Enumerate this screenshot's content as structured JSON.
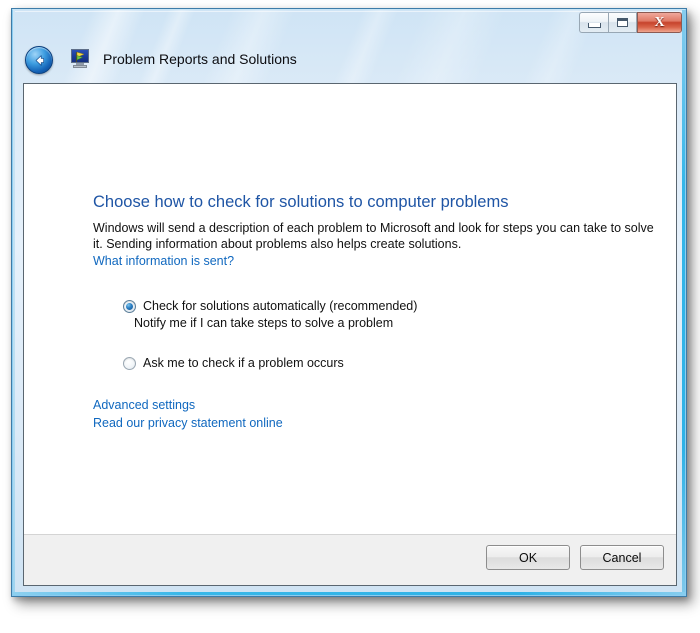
{
  "window": {
    "title": "Problem Reports and Solutions",
    "app_icon_name": "problem-reports-monitor-icon",
    "back_button_label": "Back",
    "caption": {
      "minimize_label": "Minimize",
      "maximize_label": "Maximize",
      "close_label": "X"
    }
  },
  "content": {
    "heading": "Choose how to check for solutions to computer problems",
    "paragraph_line1": "Windows will send a description of each problem to Microsoft and look for steps you can take to solve it.",
    "paragraph_line2": "Sending information about problems also helps create solutions.",
    "info_link": "What information is sent?",
    "options": [
      {
        "label": "Check for solutions automatically (recommended)",
        "sublabel": "Notify me if I can take steps to solve a problem",
        "selected": true
      },
      {
        "label": "Ask me to check if a problem occurs",
        "sublabel": "",
        "selected": false
      }
    ],
    "links": [
      "Advanced settings",
      "Read our privacy statement online"
    ]
  },
  "footer": {
    "ok_label": "OK",
    "cancel_label": "Cancel"
  },
  "colors": {
    "heading_blue": "#1f55a5",
    "link_blue": "#1068bf",
    "frame_glass": "#dceaf7",
    "close_red": "#c6432c",
    "footer_gray": "#f0f0f0",
    "radio_dot_blue": "#2a7fc4"
  }
}
